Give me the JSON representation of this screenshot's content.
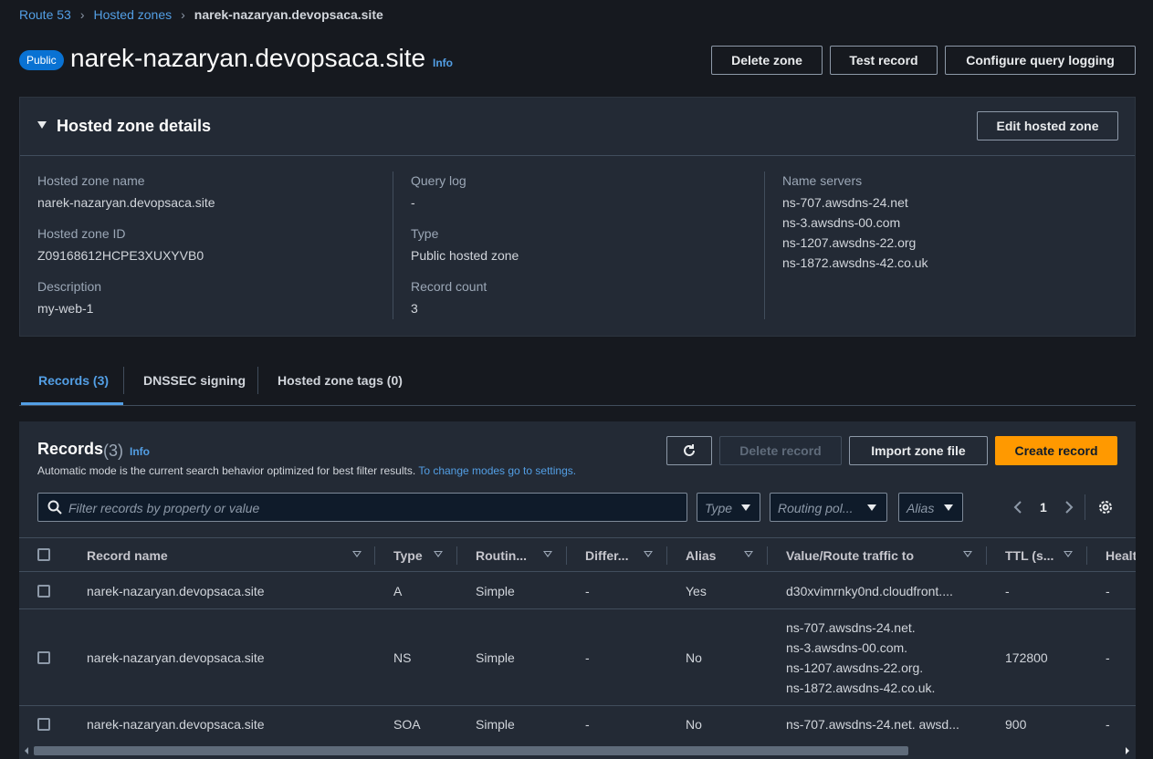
{
  "breadcrumb": {
    "items": [
      "Route 53",
      "Hosted zones"
    ],
    "current": "narek-nazaryan.devopsaca.site"
  },
  "header": {
    "badge": "Public",
    "title": "narek-nazaryan.devopsaca.site",
    "info": "Info",
    "buttons": {
      "delete_zone": "Delete zone",
      "test_record": "Test record",
      "configure_logging": "Configure query logging"
    }
  },
  "details": {
    "title": "Hosted zone details",
    "edit_button": "Edit hosted zone",
    "zone_name_label": "Hosted zone name",
    "zone_name": "narek-nazaryan.devopsaca.site",
    "zone_id_label": "Hosted zone ID",
    "zone_id": "Z09168612HCPE3XUXYVB0",
    "description_label": "Description",
    "description": "my-web-1",
    "query_log_label": "Query log",
    "query_log": "-",
    "type_label": "Type",
    "type": "Public hosted zone",
    "record_count_label": "Record count",
    "record_count": "3",
    "name_servers_label": "Name servers",
    "name_servers": [
      "ns-707.awsdns-24.net",
      "ns-3.awsdns-00.com",
      "ns-1207.awsdns-22.org",
      "ns-1872.awsdns-42.co.uk"
    ]
  },
  "tabs": [
    {
      "label": "Records (3)",
      "active": true
    },
    {
      "label": "DNSSEC signing",
      "active": false
    },
    {
      "label": "Hosted zone tags (0)",
      "active": false
    }
  ],
  "records": {
    "title": "Records",
    "count": "(3)",
    "info": "Info",
    "description": "Automatic mode is the current search behavior optimized for best filter results.",
    "description_link": "To change modes go to settings.",
    "buttons": {
      "delete_record": "Delete record",
      "import_zone": "Import zone file",
      "create_record": "Create record"
    },
    "search_placeholder": "Filter records by property or value",
    "filters": {
      "type": "Type",
      "routing": "Routing pol...",
      "alias": "Alias"
    },
    "page": "1",
    "columns": [
      "Record name",
      "Type",
      "Routin...",
      "Differ...",
      "Alias",
      "Value/Route traffic to",
      "TTL (s...",
      "Healt"
    ],
    "rows": [
      {
        "name": "narek-nazaryan.devopsaca.site",
        "type": "A",
        "routing": "Simple",
        "differ": "-",
        "alias": "Yes",
        "value": [
          "d30xvimrnky0nd.cloudfront...."
        ],
        "ttl": "-",
        "health": "-"
      },
      {
        "name": "narek-nazaryan.devopsaca.site",
        "type": "NS",
        "routing": "Simple",
        "differ": "-",
        "alias": "No",
        "value": [
          "ns-707.awsdns-24.net.",
          "ns-3.awsdns-00.com.",
          "ns-1207.awsdns-22.org.",
          "ns-1872.awsdns-42.co.uk."
        ],
        "ttl": "172800",
        "health": "-"
      },
      {
        "name": "narek-nazaryan.devopsaca.site",
        "type": "SOA",
        "routing": "Simple",
        "differ": "-",
        "alias": "No",
        "value": [
          "ns-707.awsdns-24.net. awsd..."
        ],
        "ttl": "900",
        "health": "-"
      }
    ]
  },
  "colors": {
    "background": "#16191f",
    "panel": "#232a35",
    "link": "#539fe5",
    "primary": "#ff9900",
    "badge": "#0972d3"
  }
}
